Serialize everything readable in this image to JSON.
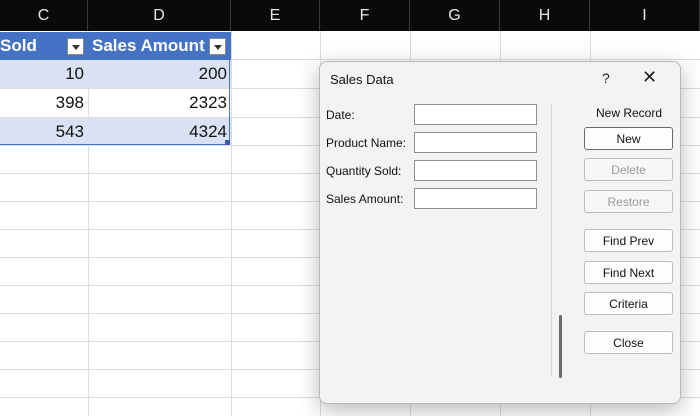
{
  "sheet": {
    "columns": [
      "C",
      "D",
      "E",
      "F",
      "G",
      "H",
      "I"
    ],
    "table_headers": {
      "col_c": "Sold",
      "col_d": "Sales Amount"
    },
    "rows": [
      {
        "quantity": "10",
        "amount": "200"
      },
      {
        "quantity": "398",
        "amount": "2323"
      },
      {
        "quantity": "543",
        "amount": "4324"
      }
    ]
  },
  "dialog": {
    "title": "Sales Data",
    "help": "?",
    "close": "✕",
    "fields": [
      {
        "label": "Date:",
        "value": ""
      },
      {
        "label": "Product Name:",
        "value": ""
      },
      {
        "label": "Quantity Sold:",
        "value": ""
      },
      {
        "label": "Sales Amount:",
        "value": ""
      }
    ],
    "record_status": "New Record",
    "buttons": {
      "new": "New",
      "delete": "Delete",
      "restore": "Restore",
      "find_prev": "Find Prev",
      "find_next": "Find Next",
      "criteria": "Criteria",
      "close": "Close"
    }
  },
  "colors": {
    "header_bg": "#0a0a0a",
    "table_header": "#4472c4",
    "band": "#d9e1f2"
  }
}
